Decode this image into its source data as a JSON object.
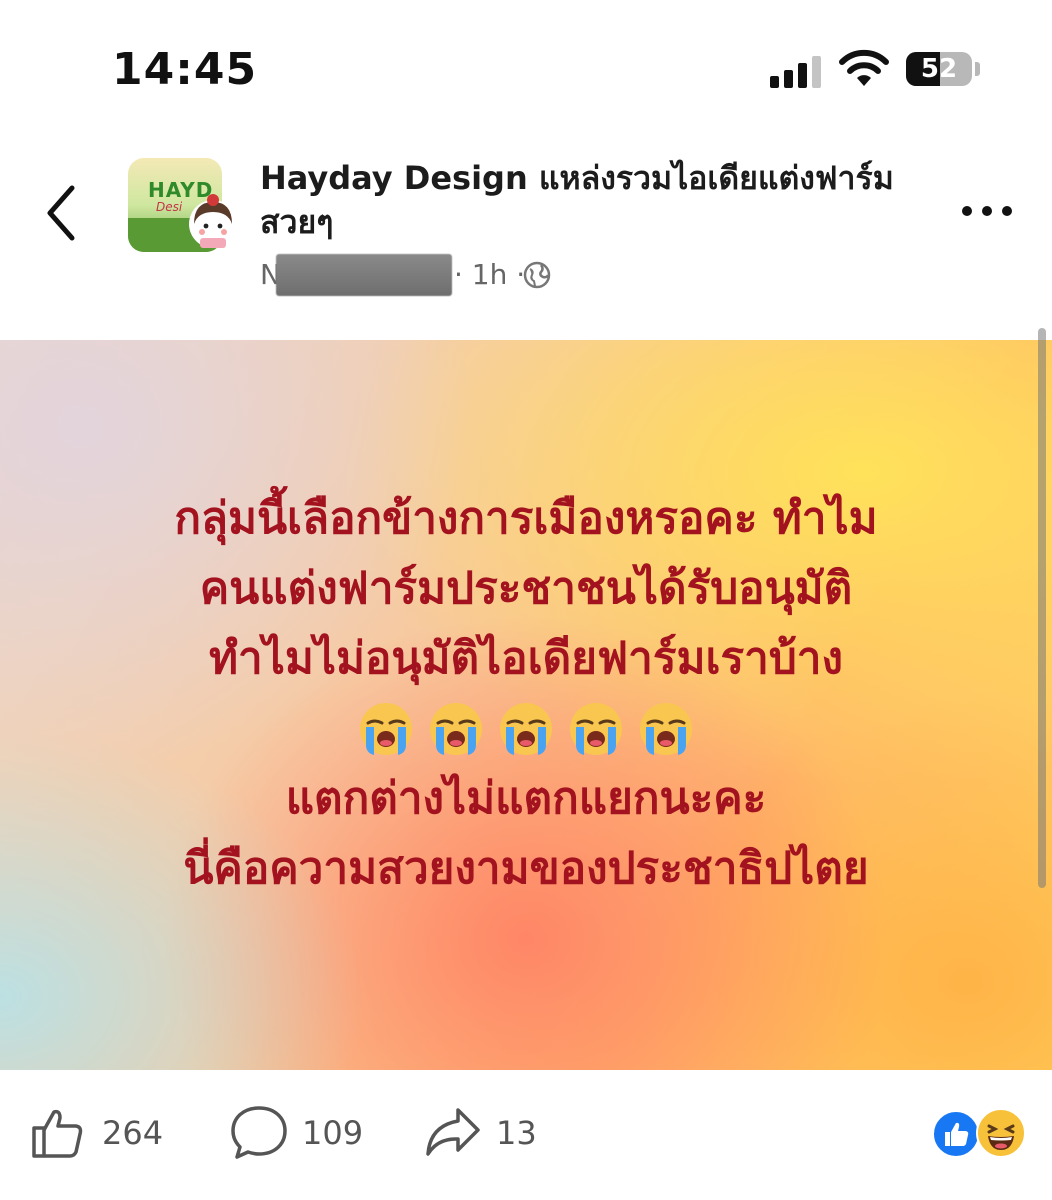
{
  "status_bar": {
    "time": "14:45",
    "battery_level": "52"
  },
  "header": {
    "group_name": "Hayday Design แหล่งรวมไอเดียแต่งฟาร์มสวยๆ",
    "avatar_title": "HAYD",
    "avatar_sub": "Desi",
    "author_initial": "N",
    "time_ago": "· 1h ·",
    "privacy_icon": "globe-icon"
  },
  "post": {
    "lines": [
      "กลุ่มนี้เลือกข้างการเมืองหรอคะ ทำไม",
      "คนแต่งฟาร์มประชาชนได้รับอนุมัติ",
      "ทำไมไม่อนุมัติไอเดียฟาร์มเราบ้าง",
      "แตกต่างไม่แตกแยกนะคะ",
      "นี่คือความสวยงามของประชาธิปไตย"
    ],
    "emoji_count": 5,
    "emoji": "loudly-crying-face-emoji",
    "text_color": "#a3121f"
  },
  "actions": {
    "likes": "264",
    "comments": "109",
    "shares": "13",
    "reactions": [
      "like-reaction-icon",
      "haha-reaction-icon"
    ]
  },
  "colors": {
    "like_blue": "#1877f2",
    "haha_yellow": "#f7c23a"
  }
}
